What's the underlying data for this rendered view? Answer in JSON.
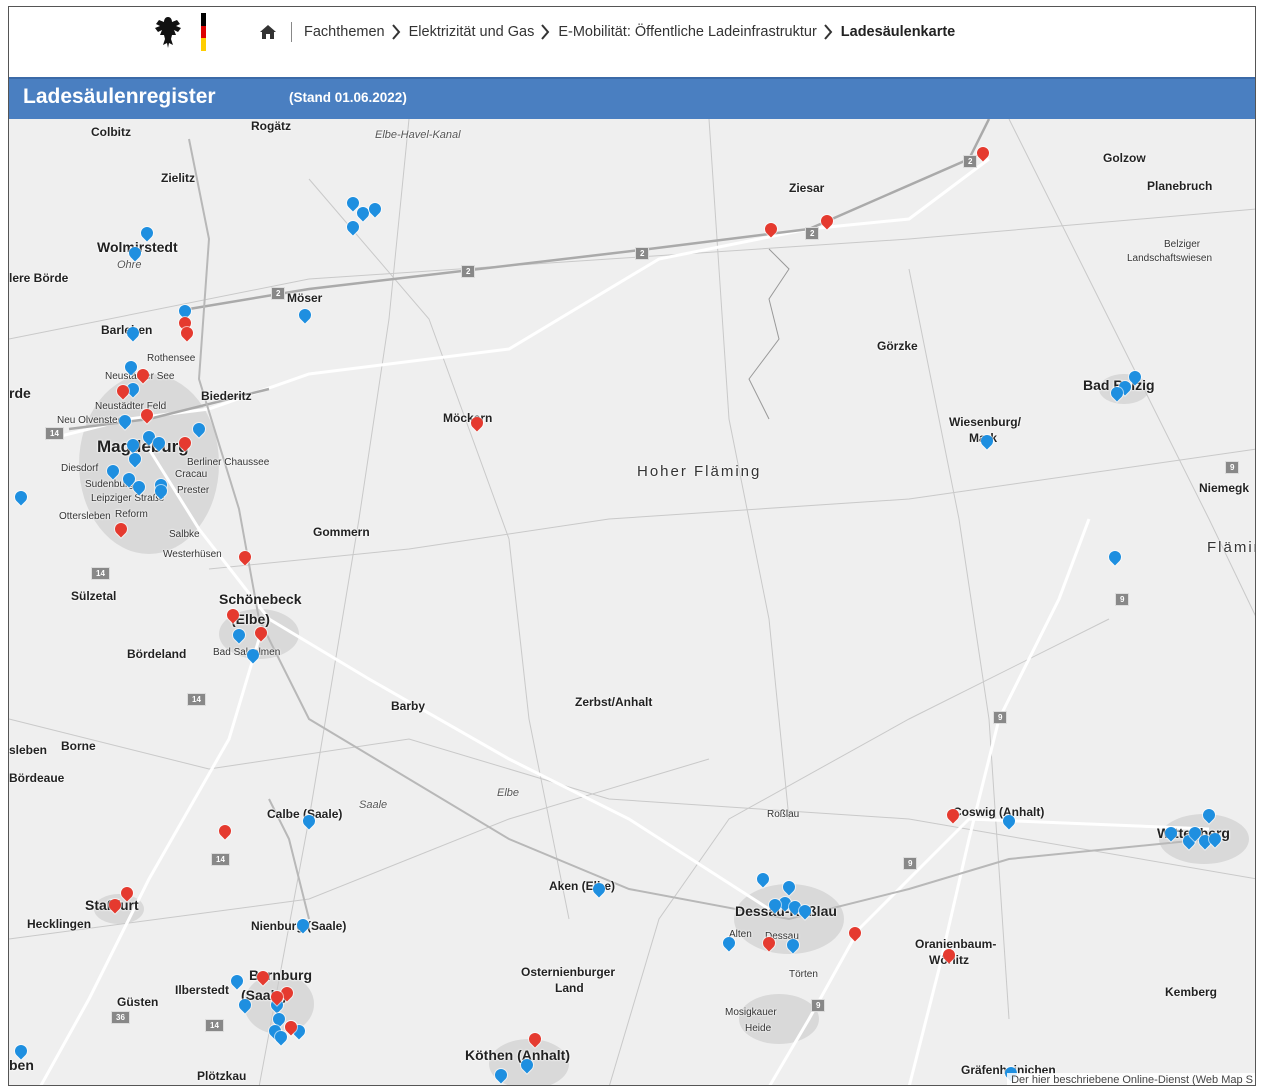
{
  "breadcrumb": [
    "Fachthemen",
    "Elektrizität und Gas",
    "E-Mobilität: Öffentliche Ladeinfrastruktur",
    "Ladesäulenkarte"
  ],
  "header": {
    "title": "Ladesäulenregister",
    "stand": "(Stand 01.06.2022)"
  },
  "colors": {
    "header_bar": "#4a7fc1",
    "marker_blue": "#1e8fe0",
    "marker_red": "#e53a2f",
    "flag": [
      "#000000",
      "#dd0000",
      "#ffce00"
    ]
  },
  "icons": [
    "home-icon",
    "chevron-right-icon",
    "eagle-logo",
    "flag-stripe"
  ],
  "map": {
    "places": [
      {
        "t": "Colbitz",
        "c": "pl"
      },
      {
        "t": "Rogätz",
        "c": "pl"
      },
      {
        "t": "Zielitz",
        "c": "pl"
      },
      {
        "t": "Wolmirstedt",
        "c": "pl med"
      },
      {
        "t": "Ohre",
        "c": "pl river"
      },
      {
        "t": "lere Börde",
        "c": "pl"
      },
      {
        "t": "Barleben",
        "c": "pl"
      },
      {
        "t": "Rothensee",
        "c": "pl sm"
      },
      {
        "t": "Neustädter See",
        "c": "pl sm"
      },
      {
        "t": "rde",
        "c": "pl med"
      },
      {
        "t": "Neustädter Feld",
        "c": "pl sm"
      },
      {
        "t": "Neu Olvenstedt",
        "c": "pl sm"
      },
      {
        "t": "Biederitz",
        "c": "pl"
      },
      {
        "t": "Magdeburg",
        "c": "pl big"
      },
      {
        "t": "Berliner Chaussee",
        "c": "pl sm"
      },
      {
        "t": "Diesdorf",
        "c": "pl sm"
      },
      {
        "t": "Cracau",
        "c": "pl sm"
      },
      {
        "t": "Sudenburg",
        "c": "pl sm"
      },
      {
        "t": "Prester",
        "c": "pl sm"
      },
      {
        "t": "Leipziger Straße",
        "c": "pl sm"
      },
      {
        "t": "Ottersleben",
        "c": "pl sm"
      },
      {
        "t": "Reform",
        "c": "pl sm"
      },
      {
        "t": "Salbke",
        "c": "pl sm"
      },
      {
        "t": "Westerhüsen",
        "c": "pl sm"
      },
      {
        "t": "Gommern",
        "c": "pl"
      },
      {
        "t": "Möser",
        "c": "pl"
      },
      {
        "t": "Möckern",
        "c": "pl"
      },
      {
        "t": "Sülzetal",
        "c": "pl"
      },
      {
        "t": "Schönebeck",
        "c": "pl med"
      },
      {
        "t": "(Elbe)",
        "c": "pl med"
      },
      {
        "t": "Bad Salzelmen",
        "c": "pl sm"
      },
      {
        "t": "Bördeland",
        "c": "pl"
      },
      {
        "t": "Barby",
        "c": "pl"
      },
      {
        "t": "Zerbst/Anhalt",
        "c": "pl"
      },
      {
        "t": "Hoher Fläming",
        "c": "pl region"
      },
      {
        "t": "Görzke",
        "c": "pl"
      },
      {
        "t": "Ziesar",
        "c": "pl"
      },
      {
        "t": "Golzow",
        "c": "pl"
      },
      {
        "t": "Planebruch",
        "c": "pl"
      },
      {
        "t": "Belziger",
        "c": "pl sm"
      },
      {
        "t": "Landschaftswiesen",
        "c": "pl sm"
      },
      {
        "t": "Bad Belzig",
        "c": "pl med"
      },
      {
        "t": "Wiesenburg/",
        "c": "pl"
      },
      {
        "t": "Mark",
        "c": "pl"
      },
      {
        "t": "Niemegk",
        "c": "pl"
      },
      {
        "t": "Fläming",
        "c": "pl region"
      },
      {
        "t": "sleben",
        "c": "pl"
      },
      {
        "t": "Borne",
        "c": "pl"
      },
      {
        "t": "Bördeaue",
        "c": "pl"
      },
      {
        "t": "Calbe (Saale)",
        "c": "pl"
      },
      {
        "t": "Saale",
        "c": "pl river"
      },
      {
        "t": "Elbe",
        "c": "pl river"
      },
      {
        "t": "Staßfurt",
        "c": "pl med"
      },
      {
        "t": "Hecklingen",
        "c": "pl"
      },
      {
        "t": "Nienburg (Saale)",
        "c": "pl"
      },
      {
        "t": "Bernburg",
        "c": "pl med"
      },
      {
        "t": "(Saale)",
        "c": "pl med"
      },
      {
        "t": "Ilberstedt",
        "c": "pl"
      },
      {
        "t": "Güsten",
        "c": "pl"
      },
      {
        "t": "Aken (Elbe)",
        "c": "pl"
      },
      {
        "t": "Osternienburger",
        "c": "pl"
      },
      {
        "t": "Land",
        "c": "pl"
      },
      {
        "t": "Köthen (Anhalt)",
        "c": "pl med"
      },
      {
        "t": "Dessau-Roßlau",
        "c": "pl med"
      },
      {
        "t": "Roßlau",
        "c": "pl sm"
      },
      {
        "t": "Dessau",
        "c": "pl sm"
      },
      {
        "t": "Alten",
        "c": "pl sm"
      },
      {
        "t": "Törten",
        "c": "pl sm"
      },
      {
        "t": "Mosigkauer",
        "c": "pl sm"
      },
      {
        "t": "Heide",
        "c": "pl sm"
      },
      {
        "t": "Coswig (Anhalt)",
        "c": "pl"
      },
      {
        "t": "Wittenberg",
        "c": "pl med"
      },
      {
        "t": "Oranienbaum-",
        "c": "pl"
      },
      {
        "t": "Wörlitz",
        "c": "pl"
      },
      {
        "t": "Kemberg",
        "c": "pl"
      },
      {
        "t": "Gräfenhainichen",
        "c": "pl"
      },
      {
        "t": "Plötzkau",
        "c": "pl"
      },
      {
        "t": "ben",
        "c": "pl med"
      },
      {
        "t": "Elbe-Havel-Kanal",
        "c": "pl river"
      }
    ],
    "attribution": "Der hier beschriebene Online-Dienst (Web Map S"
  }
}
